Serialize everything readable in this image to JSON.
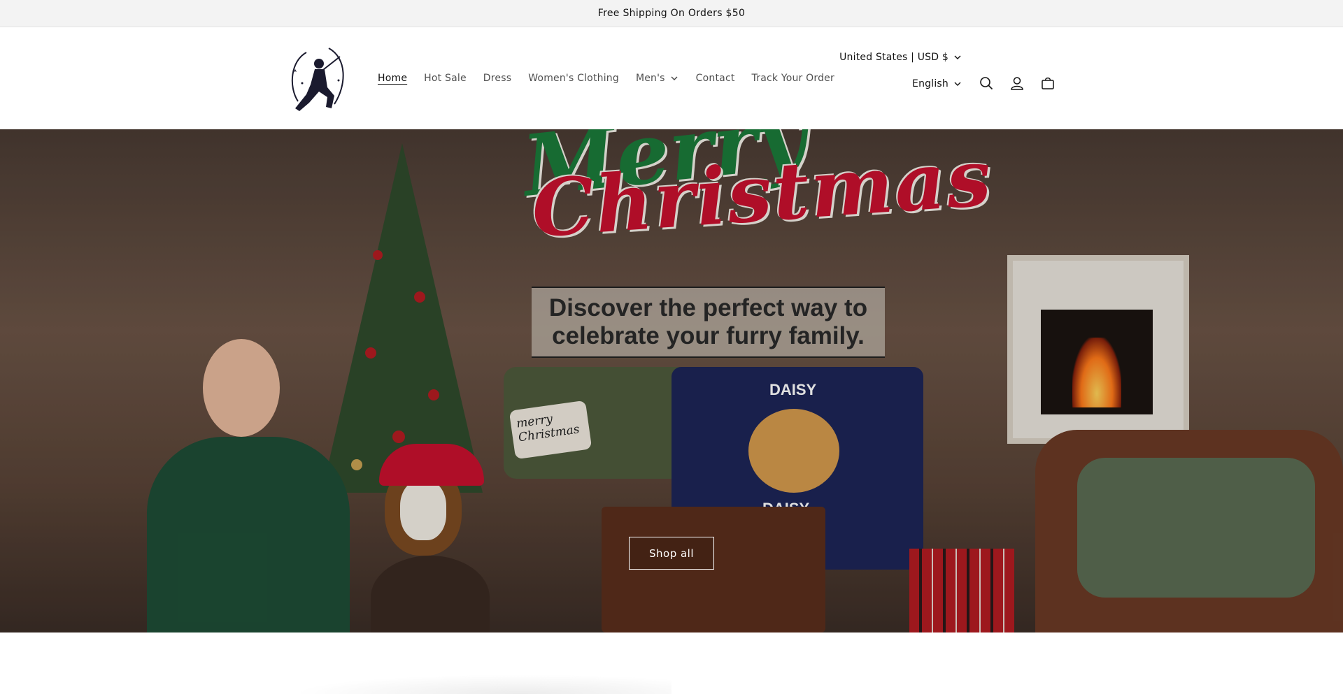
{
  "announcement": {
    "text": "Free Shipping On Orders $50"
  },
  "header": {
    "nav": [
      {
        "label": "Home",
        "active": true
      },
      {
        "label": "Hot Sale"
      },
      {
        "label": "Dress"
      },
      {
        "label": "Women's Clothing"
      },
      {
        "label": "Men's",
        "has_dropdown": true
      },
      {
        "label": "Contact"
      },
      {
        "label": "Track Your Order"
      }
    ],
    "localization": {
      "country_currency": "United States | USD $",
      "language": "English"
    },
    "icons": [
      "search-icon",
      "account-icon",
      "cart-icon"
    ]
  },
  "hero": {
    "title_line1": "Merry",
    "title_line2": "Christmas",
    "subtitle": "Discover the perfect way to celebrate your furry family.",
    "pillow_text": "merry Christmas",
    "blanket_name": "DAISY",
    "button_label": "Shop all",
    "colors": {
      "title_green": "#1b7a3a",
      "title_red": "#c8102e"
    }
  }
}
